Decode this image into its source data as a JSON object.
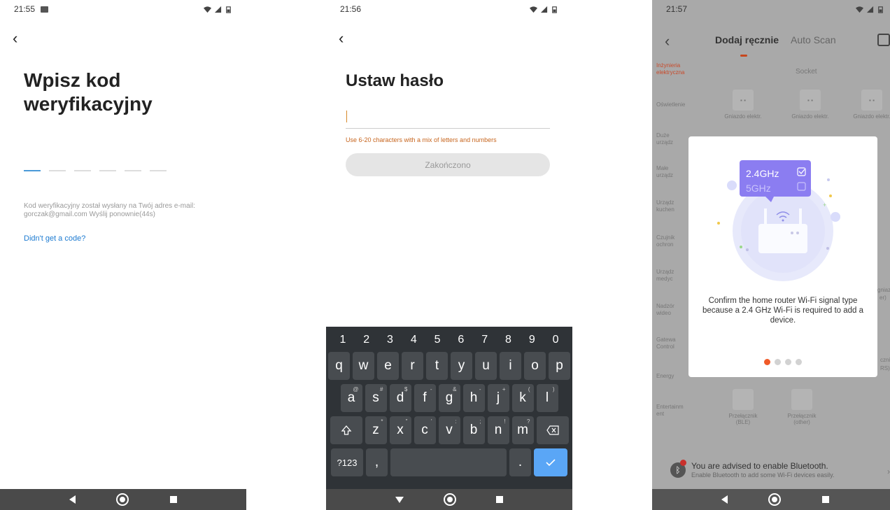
{
  "screen1": {
    "time": "21:55",
    "title": "Wpisz kod weryfikacyjny",
    "code_slots": 6,
    "info_line1": "Kod weryfikacyjny został wysłany na Twój adres e-mail:",
    "info_line2": "gorczak@gmail.com  Wyślij ponownie(44s)",
    "link": "Didn't get a code?",
    "back_icon": "chevron-left-icon"
  },
  "screen2": {
    "time": "21:56",
    "title": "Ustaw hasło",
    "password_value": "",
    "hint": "Use 6-20 characters with a mix of letters and numbers",
    "done_label": "Zakończono",
    "keyboard": {
      "numbers": [
        "1",
        "2",
        "3",
        "4",
        "5",
        "6",
        "7",
        "8",
        "9",
        "0"
      ],
      "row1": [
        "q",
        "w",
        "e",
        "r",
        "t",
        "y",
        "u",
        "i",
        "o",
        "p"
      ],
      "row2": [
        "a",
        "s",
        "d",
        "f",
        "g",
        "h",
        "j",
        "k",
        "l"
      ],
      "row2_sup": [
        "@",
        "#",
        "$",
        "-",
        "&",
        "-",
        "+",
        "(",
        ")"
      ],
      "row3": [
        "z",
        "x",
        "c",
        "v",
        "b",
        "n",
        "m"
      ],
      "row3_sup": [
        "*",
        "\"",
        "'",
        ":",
        ";",
        "!",
        "?"
      ],
      "symbols_label": "?123",
      "comma": ",",
      "period": ".",
      "shift_icon": "shift-icon",
      "backspace_icon": "backspace-icon",
      "enter_icon": "check-icon"
    }
  },
  "screen3": {
    "time": "21:57",
    "tab_manual": "Dodaj ręcznie",
    "tab_auto": "Auto Scan",
    "categories": [
      "Inżynieria elektryczna",
      "Oświetlenie",
      "Duże urządz",
      "Małe urządz",
      "Urządz kuchen",
      "Czujnik ochron",
      "Urządz medyc",
      "Nadzór wideo",
      "Gatewa Control",
      "Energy",
      "Entertainm ent"
    ],
    "socket_header": "Socket",
    "socket_items": [
      {
        "label": "Gniazdo elektr."
      },
      {
        "label": "Gniazdo elektr."
      },
      {
        "label": "Gniazdo elektr."
      }
    ],
    "partial_label_1": "gniazd",
    "partial_label_2": "er)",
    "partial_label_3": "cznik",
    "partial_label_4": "RS)",
    "bottom_items": [
      {
        "label": "Przełącznik (BLE)"
      },
      {
        "label": "Przełącznik (other)"
      }
    ],
    "modal": {
      "band1": "2.4GHz",
      "band2": "5GHz",
      "message": "Confirm the home router Wi-Fi signal type because a 2.4 GHz Wi-Fi is required to add a device.",
      "page_count": 4,
      "active_page": 1
    },
    "bluetooth": {
      "title": "You are advised to enable Bluetooth.",
      "subtitle": "Enable Bluetooth to add some Wi-Fi devices easily."
    }
  },
  "colors": {
    "accent_orange": "#f05a28",
    "link_blue": "#1d7bd1",
    "hint_orange": "#c7651e",
    "key_bg": "#484c50",
    "keyboard_bg": "#2f3337",
    "enter_blue": "#5aa6f6",
    "modal_purple": "#8b7df1"
  }
}
